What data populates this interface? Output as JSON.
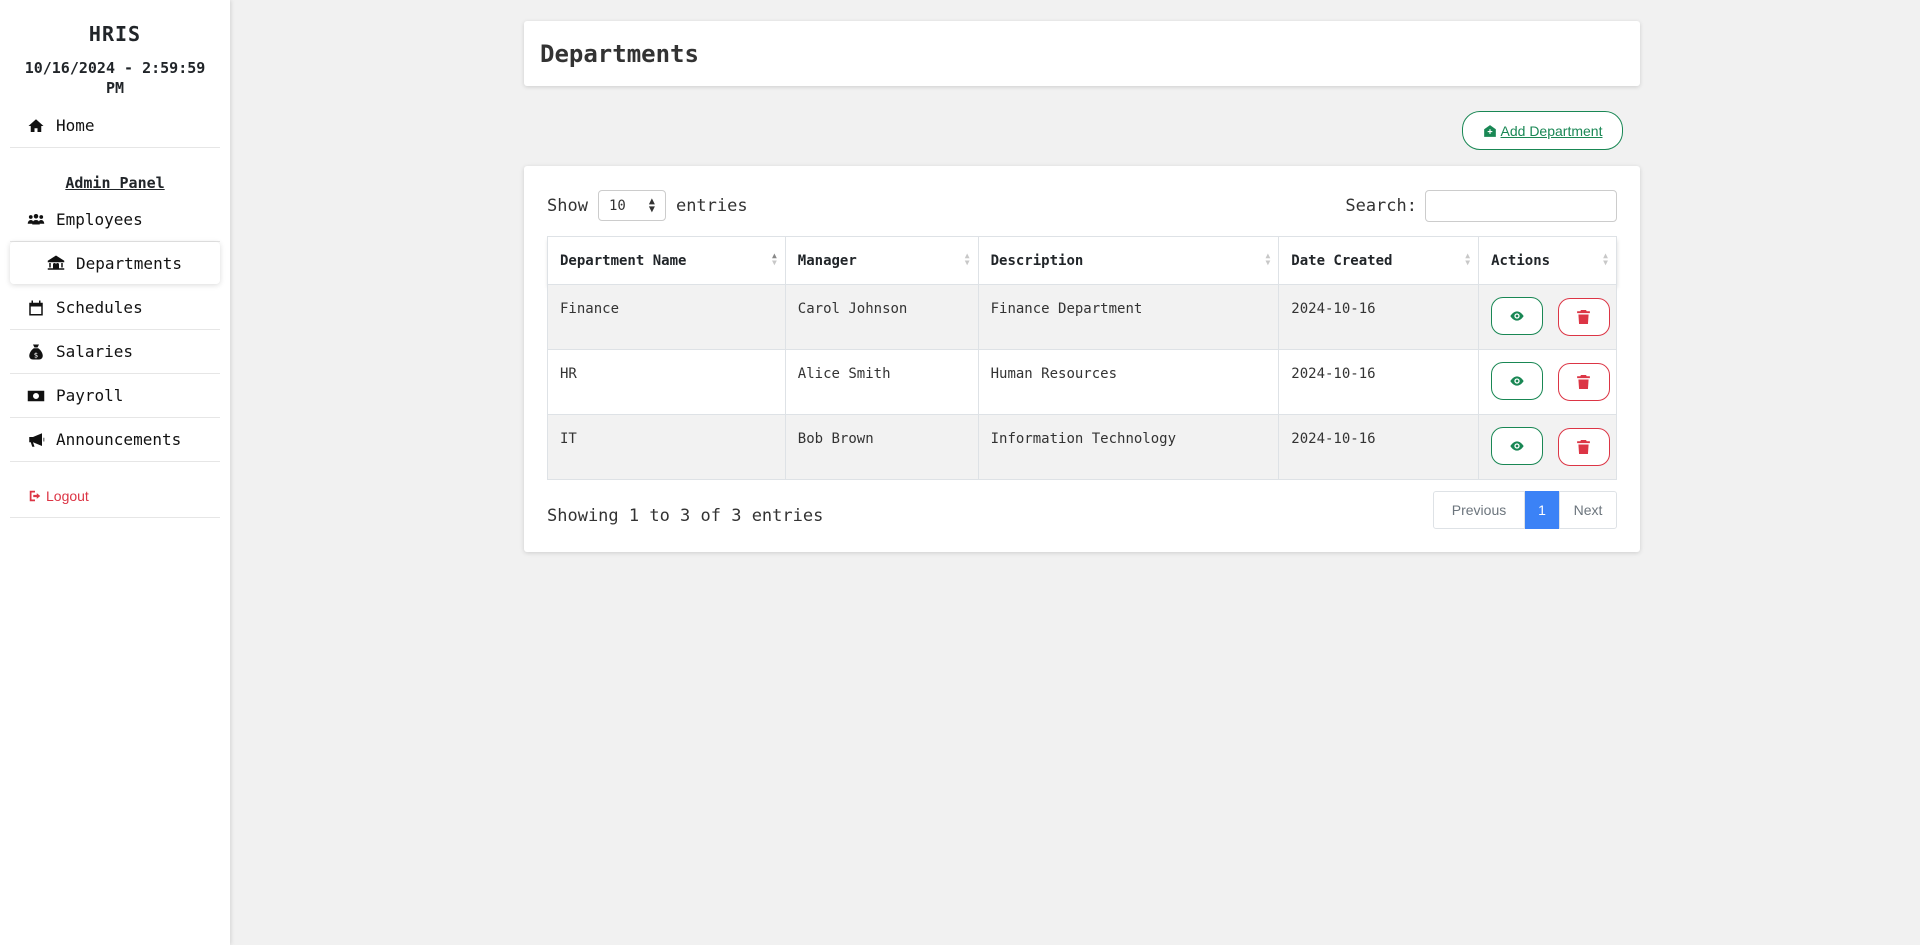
{
  "sidebar": {
    "brand": "HRIS",
    "datetime": "10/16/2024 - 2:59:59 PM",
    "home": {
      "label": "Home",
      "icon": "home-icon"
    },
    "admin_panel_label": "Admin Panel",
    "items": [
      {
        "label": "Employees",
        "icon": "users-icon"
      },
      {
        "label": "Departments",
        "icon": "building-icon",
        "active": true
      },
      {
        "label": "Schedules",
        "icon": "calendar-icon"
      },
      {
        "label": "Salaries",
        "icon": "money-bag-icon"
      },
      {
        "label": "Payroll",
        "icon": "money-bill-icon"
      },
      {
        "label": "Announcements",
        "icon": "megaphone-icon"
      }
    ],
    "logout": {
      "label": "Logout",
      "icon": "sign-out-icon"
    }
  },
  "header": {
    "title": "Departments"
  },
  "toolbar": {
    "add_label": "Add Department",
    "add_icon": "add-building-icon"
  },
  "table_controls": {
    "show_label": "Show",
    "entries_value": "10",
    "entries_label": "entries",
    "search_label": "Search:",
    "search_value": ""
  },
  "table": {
    "columns": [
      "Department Name",
      "Manager",
      "Description",
      "Date Created",
      "Actions"
    ],
    "rows": [
      {
        "name": "Finance",
        "manager": "Carol Johnson",
        "description": "Finance Department",
        "date": "2024-10-16"
      },
      {
        "name": "HR",
        "manager": "Alice Smith",
        "description": "Human Resources",
        "date": "2024-10-16"
      },
      {
        "name": "IT",
        "manager": "Bob Brown",
        "description": "Information Technology",
        "date": "2024-10-16"
      }
    ]
  },
  "footer": {
    "info": "Showing 1 to 3 of 3 entries",
    "pagination": {
      "previous": "Previous",
      "current": "1",
      "next": "Next"
    }
  },
  "colors": {
    "primary": "#3b82f6",
    "success": "#198754",
    "danger": "#dc3545",
    "background": "#f1f1f1"
  }
}
